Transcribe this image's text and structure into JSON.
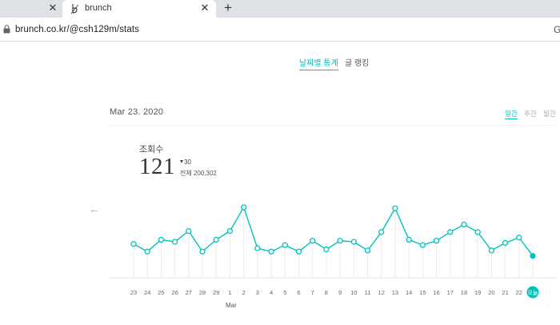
{
  "browser": {
    "tab_title": "brunch",
    "url": "brunch.co.kr/@csh129m/stats",
    "google_icon_letter": "G",
    "close_glyph": "✕",
    "new_tab_glyph": "+"
  },
  "stats_nav": {
    "daily_stats": "날짜별 통계",
    "ranking": "글 랭킹"
  },
  "date_header": {
    "date": "Mar 23. 2020",
    "periods": [
      "일간",
      "주간",
      "월간"
    ],
    "selected_period": "일간"
  },
  "views": {
    "label": "조회수",
    "count": "121",
    "change": "30",
    "total": "전체 200,302"
  },
  "prev_arrow": "←",
  "colors": {
    "accent": "#00c3bd",
    "tab_bar": "#dee1e6"
  },
  "chart_data": {
    "type": "line",
    "x": [
      "23",
      "24",
      "25",
      "26",
      "27",
      "28",
      "29",
      "1",
      "2",
      "3",
      "4",
      "5",
      "6",
      "7",
      "8",
      "9",
      "10",
      "11",
      "12",
      "13",
      "14",
      "15",
      "16",
      "17",
      "18",
      "19",
      "20",
      "21",
      "22",
      "23"
    ],
    "selected_label": "오늘",
    "month_label": "Mar",
    "series": [
      {
        "values": [
          132,
          125,
          136,
          134,
          144,
          125,
          136,
          144,
          166,
          128,
          125,
          131,
          125,
          135,
          127,
          135,
          134,
          126,
          143,
          165,
          136,
          131,
          135,
          143,
          150,
          143,
          126,
          133,
          138,
          121
        ]
      }
    ],
    "ylim": [
      100,
      180
    ],
    "grid": true
  }
}
